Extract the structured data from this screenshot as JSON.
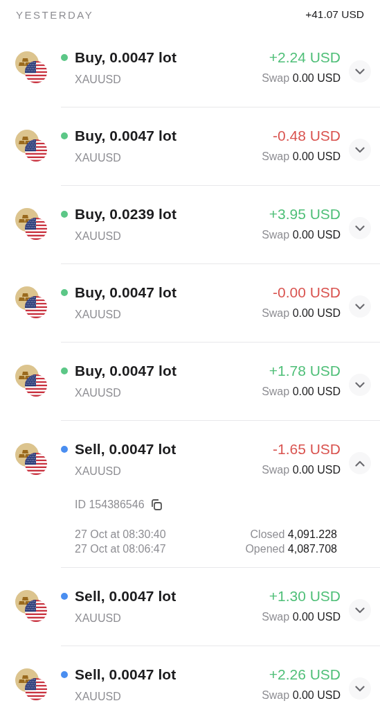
{
  "section": {
    "label": "YESTERDAY",
    "total": "+41.07 USD"
  },
  "trades": [
    {
      "title": "Buy, 0.0047 lot",
      "color": "#5cc787",
      "symbol": "XAUUSD",
      "amount": "+2.24 USD",
      "kind": "profit",
      "swap_label": "Swap",
      "swap": "0.00 USD",
      "expanded": false
    },
    {
      "title": "Buy, 0.0047 lot",
      "color": "#5cc787",
      "symbol": "XAUUSD",
      "amount": "-0.48 USD",
      "kind": "loss",
      "swap_label": "Swap",
      "swap": "0.00 USD",
      "expanded": false
    },
    {
      "title": "Buy, 0.0239 lot",
      "color": "#5cc787",
      "symbol": "XAUUSD",
      "amount": "+3.95 USD",
      "kind": "profit",
      "swap_label": "Swap",
      "swap": "0.00 USD",
      "expanded": false
    },
    {
      "title": "Buy, 0.0047 lot",
      "color": "#5cc787",
      "symbol": "XAUUSD",
      "amount": "-0.00 USD",
      "kind": "loss",
      "swap_label": "Swap",
      "swap": "0.00 USD",
      "expanded": false
    },
    {
      "title": "Buy, 0.0047 lot",
      "color": "#5cc787",
      "symbol": "XAUUSD",
      "amount": "+1.78 USD",
      "kind": "profit",
      "swap_label": "Swap",
      "swap": "0.00 USD",
      "expanded": false
    },
    {
      "title": "Sell, 0.0047 lot",
      "color": "#4a8ef0",
      "symbol": "XAUUSD",
      "amount": "-1.65 USD",
      "kind": "loss",
      "swap_label": "Swap",
      "swap": "0.00 USD",
      "expanded": true,
      "details": {
        "id": "ID 154386546",
        "close_time": "27 Oct at 08:30:40",
        "open_time": "27 Oct at 08:06:47",
        "closed_label": "Closed",
        "closed_price": "4,091.228",
        "opened_label": "Opened",
        "opened_price": "4,087.708"
      }
    },
    {
      "title": "Sell, 0.0047 lot",
      "color": "#4a8ef0",
      "symbol": "XAUUSD",
      "amount": "+1.30 USD",
      "kind": "profit",
      "swap_label": "Swap",
      "swap": "0.00 USD",
      "expanded": false
    },
    {
      "title": "Sell, 0.0047 lot",
      "color": "#4a8ef0",
      "symbol": "XAUUSD",
      "amount": "+2.26 USD",
      "kind": "profit",
      "swap_label": "Swap",
      "swap": "0.00 USD",
      "expanded": false
    }
  ]
}
